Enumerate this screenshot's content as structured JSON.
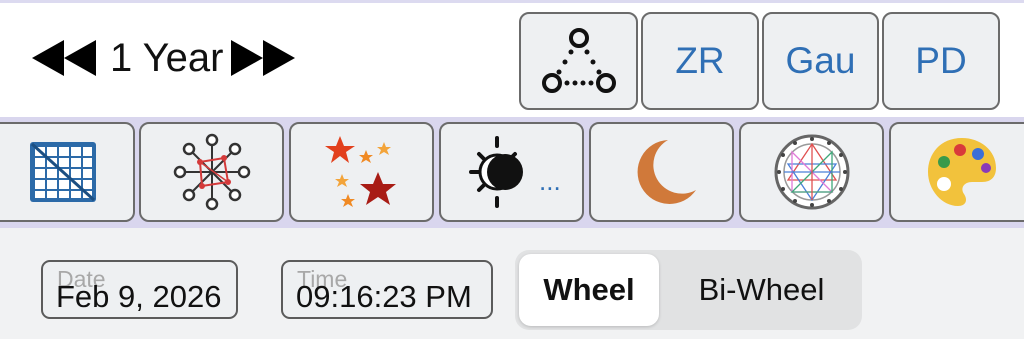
{
  "nav": {
    "prev_icon": "double-left-arrow-icon",
    "label": "1 Year",
    "next_icon": "double-right-arrow-icon"
  },
  "toolbar1": {
    "aspects_icon": "triangle-nodes-icon",
    "buttons": [
      {
        "label": "ZR"
      },
      {
        "label": "Gau"
      },
      {
        "label": "PD"
      }
    ]
  },
  "toolbar2": {
    "tools": [
      {
        "icon": "grid-table-icon"
      },
      {
        "icon": "network-nodes-icon"
      },
      {
        "icon": "stars-icon"
      },
      {
        "icon": "sun-eclipse-icon",
        "suffix": "..."
      },
      {
        "icon": "crescent-moon-icon"
      },
      {
        "icon": "chart-wheel-icon"
      },
      {
        "icon": "palette-icon"
      }
    ]
  },
  "inputs": {
    "date": {
      "label": "Date",
      "value": "Feb 9, 2026"
    },
    "time": {
      "label": "Time",
      "value": "09:16:23 PM"
    }
  },
  "view_toggle": {
    "options": [
      "Wheel",
      "Bi-Wheel"
    ],
    "selected": "Wheel"
  },
  "colors": {
    "accent_text": "#2f6fb5",
    "toolbar_band": "#d9d6ee",
    "button_bg": "#eef0f2"
  }
}
